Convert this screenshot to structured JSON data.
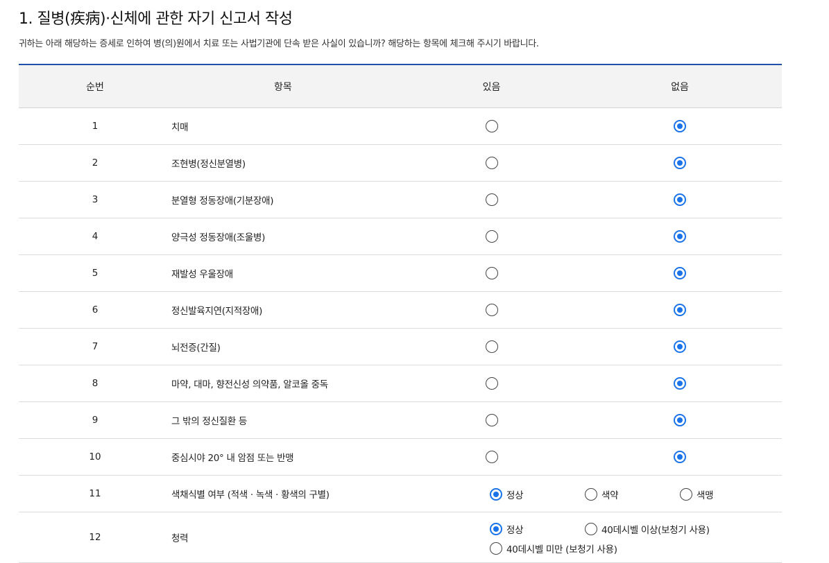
{
  "title": "1. 질병(疾病)·신체에 관한 자기 신고서 작성",
  "description": "귀하는 아래 해당하는 증세로 인하여 병(의)원에서 치료 또는 사법기관에 단속 받은 사실이 있습니까? 해당하는 항목에 체크해 주시기 바랍니다.",
  "headers": {
    "no": "순번",
    "item": "항목",
    "yes": "있음",
    "no_col": "없음"
  },
  "rows": [
    {
      "no": "1",
      "label": "치매",
      "selected": "없음"
    },
    {
      "no": "2",
      "label": "조현병(정신분열병)",
      "selected": "없음"
    },
    {
      "no": "3",
      "label": "분열형 정동장애(기분장애)",
      "selected": "없음"
    },
    {
      "no": "4",
      "label": "양극성 정동장애(조울병)",
      "selected": "없음"
    },
    {
      "no": "5",
      "label": "재발성 우울장애",
      "selected": "없음"
    },
    {
      "no": "6",
      "label": "정신발육지연(지적장애)",
      "selected": "없음"
    },
    {
      "no": "7",
      "label": "뇌전증(간질)",
      "selected": "없음"
    },
    {
      "no": "8",
      "label": "마약, 대마, 향전신성 의약품, 알코올 중독",
      "selected": "없음"
    },
    {
      "no": "9",
      "label": "그 밖의 정신질환 등",
      "selected": "없음"
    },
    {
      "no": "10",
      "label": "중심시야 20° 내 암점 또는 반맹",
      "selected": "없음"
    }
  ],
  "row11": {
    "no": "11",
    "label": "색채식별 여부 (적색 · 녹색 · 황색의 구별)",
    "options": [
      "정상",
      "색약",
      "색맹"
    ],
    "selected": "정상"
  },
  "row12": {
    "no": "12",
    "label": "청력",
    "options": [
      "정상",
      "40데시벨 이상(보청기 사용)",
      "40데시벨 미만 (보청기 사용)"
    ],
    "selected": "정상"
  },
  "colors": {
    "accent": "#1a73e8",
    "top_border": "#1f4fa8",
    "header_bg": "#f3f3f3"
  }
}
